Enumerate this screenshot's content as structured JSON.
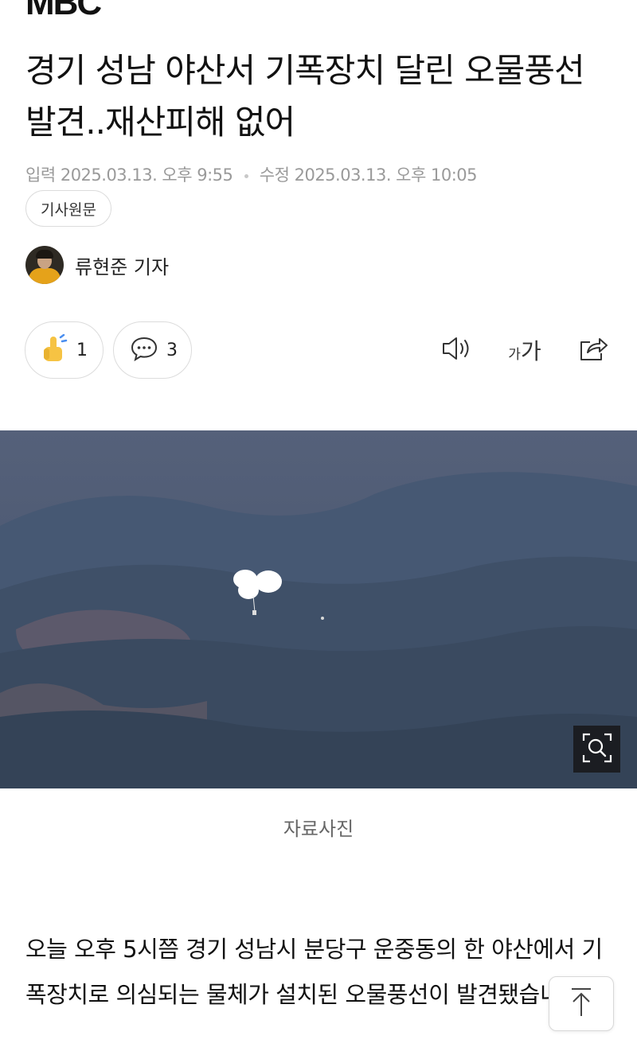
{
  "header": {
    "logo_text": "MBC"
  },
  "article": {
    "headline": "경기 성남 야산서 기폭장치 달린 오물풍선 발견..재산피해 없어",
    "published_label": "입력",
    "published": "2025.03.13. 오후 9:55",
    "updated_label": "수정",
    "updated": "2025.03.13. 오후 10:05",
    "source_chip": "기사원문",
    "reporter": "류현준 기자",
    "photo_caption": "자료사진",
    "body": "오늘 오후 5시쯤 경기 성남시 분당구 운중동의 한 야산에서 기폭장치로 의심되는 물체가 설치된 오물풍선이 발견됐습니다."
  },
  "actions": {
    "like_count": "1",
    "comment_count": "3",
    "font_small": "가",
    "font_big": "가",
    "icons": [
      "thumbs-up-icon",
      "comment-icon",
      "speaker-icon",
      "font-size-icon",
      "share-icon",
      "zoom-icon",
      "arrow-up-icon"
    ]
  },
  "colors": {
    "meta_gray": "#9a9a9a",
    "like_yellow": "#f6c343",
    "photo_sky": "#4d5972"
  }
}
